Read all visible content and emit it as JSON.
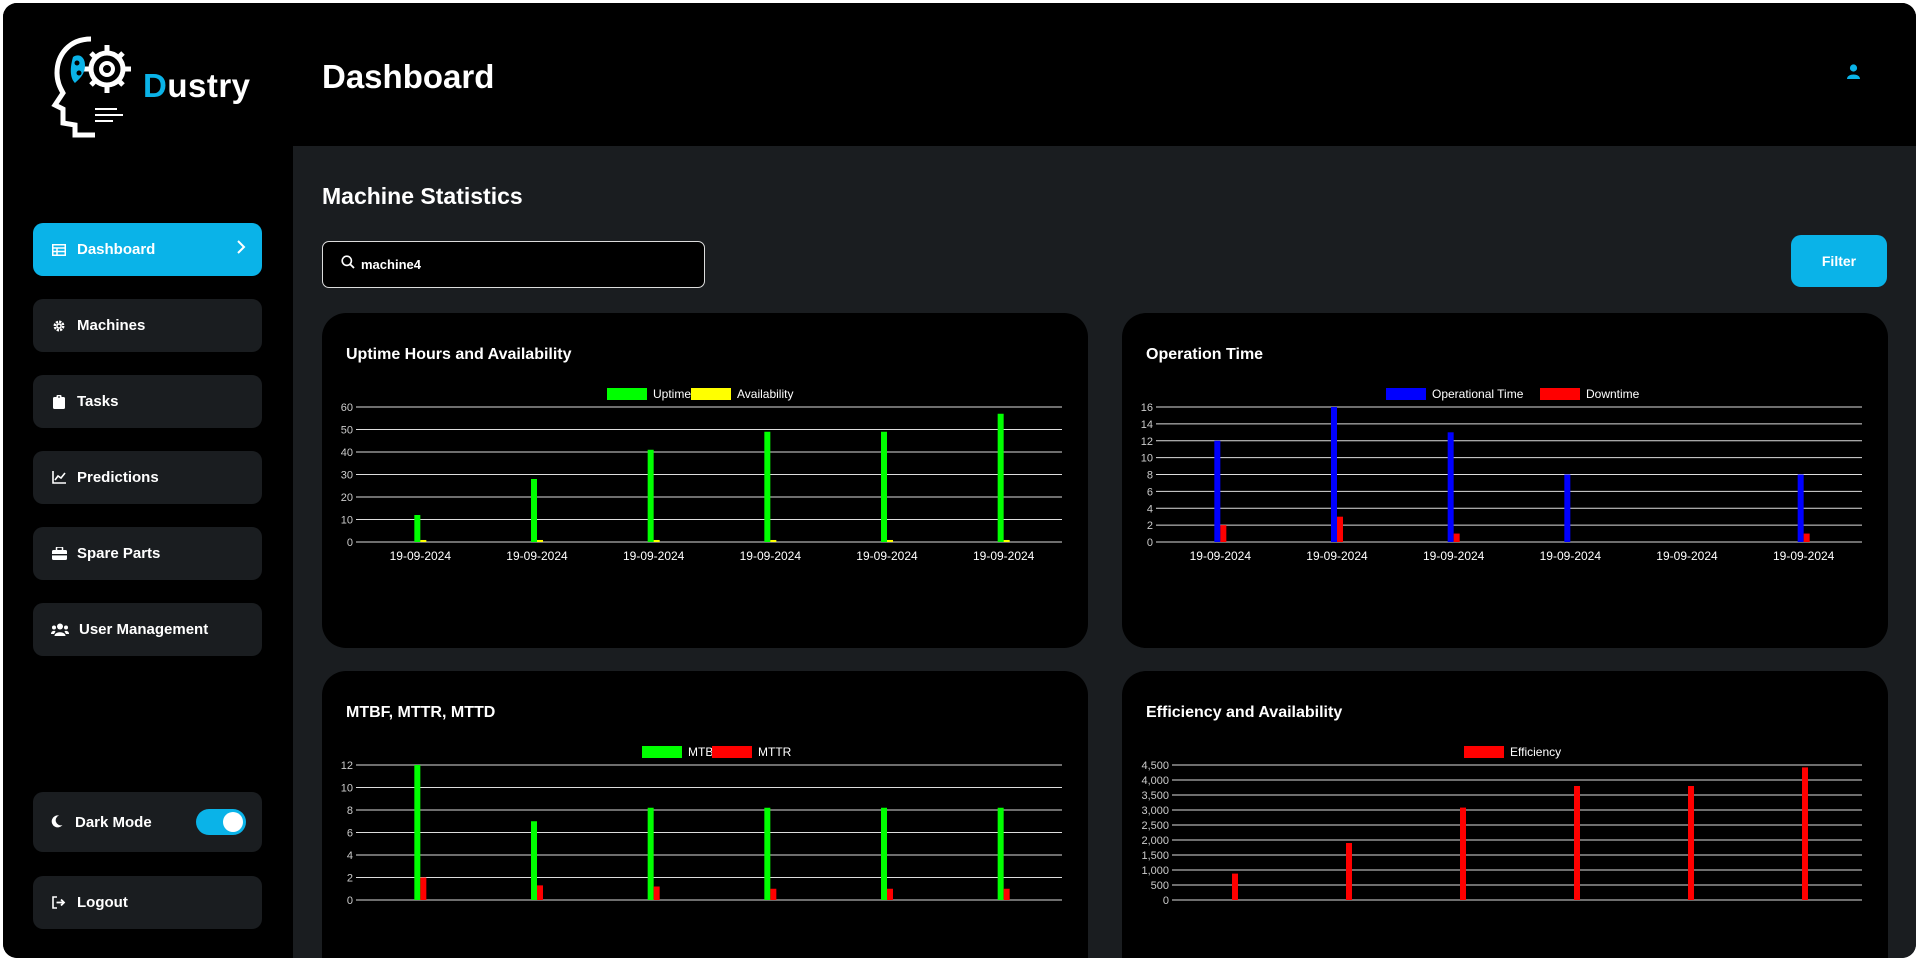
{
  "app": {
    "brand_first_letter": "D",
    "brand_rest": "ustry"
  },
  "sidebar": {
    "items": [
      {
        "label": "Dashboard",
        "icon": "table-grid-icon",
        "active": true
      },
      {
        "label": "Machines",
        "icon": "gear-icon"
      },
      {
        "label": "Tasks",
        "icon": "clipboard-icon"
      },
      {
        "label": "Predictions",
        "icon": "line-chart-icon"
      },
      {
        "label": "Spare Parts",
        "icon": "toolbox-icon"
      },
      {
        "label": "User Management",
        "icon": "users-icon"
      }
    ],
    "dark_mode_label": "Dark Mode",
    "dark_mode_on": true,
    "logout_label": "Logout"
  },
  "header": {
    "title": "Dashboard"
  },
  "main": {
    "section_title": "Machine Statistics",
    "search_value": "machine4",
    "filter_label": "Filter"
  },
  "colors": {
    "accent": "#0ab3e8",
    "green": "#00ff00",
    "yellow": "#ffff00",
    "blue": "#0000ff",
    "red": "#ff0000"
  },
  "chart_data": [
    {
      "type": "bar",
      "title": "Uptime Hours and Availability",
      "categories": [
        "19-09-2024",
        "19-09-2024",
        "19-09-2024",
        "19-09-2024",
        "19-09-2024",
        "19-09-2024"
      ],
      "series": [
        {
          "name": "Uptime",
          "color": "#00ff00",
          "values": [
            12,
            28,
            41,
            49,
            49,
            57
          ]
        },
        {
          "name": "Availability",
          "color": "#ffff00",
          "values": [
            0.9,
            0.9,
            0.9,
            0.9,
            0.9,
            0.9
          ]
        }
      ],
      "yticks": [
        "0",
        "10",
        "20",
        "30",
        "40",
        "50",
        "60"
      ],
      "ylim": [
        0,
        60
      ],
      "legend": "top-center",
      "grid": true
    },
    {
      "type": "bar",
      "title": "Operation Time",
      "categories": [
        "19-09-2024",
        "19-09-2024",
        "19-09-2024",
        "19-09-2024",
        "19-09-2024",
        "19-09-2024"
      ],
      "series": [
        {
          "name": "Operational Time",
          "color": "#0000ff",
          "values": [
            12,
            16,
            13,
            8,
            0,
            8
          ]
        },
        {
          "name": "Downtime",
          "color": "#ff0000",
          "values": [
            2,
            3,
            1,
            0,
            0,
            1
          ]
        }
      ],
      "yticks": [
        "0",
        "2",
        "4",
        "6",
        "8",
        "10",
        "12",
        "14",
        "16"
      ],
      "ylim": [
        0,
        16
      ],
      "legend": "top-center",
      "grid": true
    },
    {
      "type": "bar",
      "title": "MTBF, MTTR, MTTD",
      "categories": [
        "",
        "",
        "",
        "",
        "",
        ""
      ],
      "series": [
        {
          "name": "MTBF",
          "color": "#00ff00",
          "values": [
            12,
            7,
            8.2,
            8.2,
            8.2,
            8.2
          ]
        },
        {
          "name": "MTTR",
          "color": "#ff0000",
          "values": [
            2,
            1.3,
            1.2,
            1,
            1,
            1
          ]
        }
      ],
      "yticks": [
        "0",
        "2",
        "4",
        "6",
        "8",
        "10",
        "12"
      ],
      "ylim": [
        0,
        12
      ],
      "legend": "top-center",
      "grid": true
    },
    {
      "type": "bar",
      "title": "Efficiency and Availability",
      "categories": [
        "",
        "",
        "",
        "",
        "",
        ""
      ],
      "series": [
        {
          "name": "Efficiency",
          "color": "#ff0000",
          "values": [
            880,
            1900,
            3080,
            3800,
            3800,
            4420
          ]
        }
      ],
      "yticks": [
        "0",
        "500",
        "1,000",
        "1,500",
        "2,000",
        "2,500",
        "3,000",
        "3,500",
        "4,000",
        "4,500"
      ],
      "ylim": [
        0,
        4500
      ],
      "legend": "top-center",
      "grid": true
    }
  ]
}
